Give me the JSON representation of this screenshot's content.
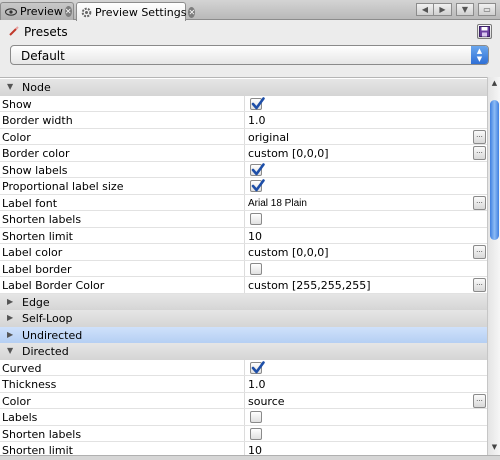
{
  "tabs": [
    {
      "label": "Preview",
      "icon": "preview-eye-icon"
    },
    {
      "label": "Preview Settings",
      "icon": "gear-icon"
    }
  ],
  "presets": {
    "title": "Presets",
    "icon": "presets-wand-icon",
    "selected": "Default",
    "save_icon": "save-disk-icon"
  },
  "sections": [
    {
      "label": "Node",
      "expanded": true,
      "properties": [
        {
          "name": "Show",
          "type": "checkbox",
          "checked": true
        },
        {
          "name": "Border width",
          "type": "text",
          "value": "1.0"
        },
        {
          "name": "Color",
          "type": "text",
          "value": "original",
          "editor": true
        },
        {
          "name": "Border color",
          "type": "text",
          "value": "custom [0,0,0]",
          "editor": true
        },
        {
          "name": "Show labels",
          "type": "checkbox",
          "checked": true
        },
        {
          "name": "Proportional label size",
          "type": "checkbox",
          "checked": true
        },
        {
          "name": "Label font",
          "type": "text",
          "value": "Arial 18 Plain",
          "editor": true
        },
        {
          "name": "Shorten labels",
          "type": "checkbox",
          "checked": false
        },
        {
          "name": "Shorten limit",
          "type": "text",
          "value": "10"
        },
        {
          "name": "Label color",
          "type": "text",
          "value": "custom [0,0,0]",
          "editor": true
        },
        {
          "name": "Label border",
          "type": "checkbox",
          "checked": false
        },
        {
          "name": "Label Border Color",
          "type": "text",
          "value": "custom [255,255,255]",
          "editor": true
        }
      ]
    },
    {
      "label": "Edge",
      "expanded": false,
      "properties": []
    },
    {
      "label": "Self-Loop",
      "expanded": false,
      "properties": []
    },
    {
      "label": "Undirected",
      "expanded": false,
      "selected": true,
      "properties": []
    },
    {
      "label": "Directed",
      "expanded": true,
      "properties": [
        {
          "name": "Curved",
          "type": "checkbox",
          "checked": true
        },
        {
          "name": "Thickness",
          "type": "text",
          "value": "1.0"
        },
        {
          "name": "Color",
          "type": "text",
          "value": "source",
          "editor": true
        },
        {
          "name": "Labels",
          "type": "checkbox",
          "checked": false
        },
        {
          "name": "Shorten labels",
          "type": "checkbox",
          "checked": false
        },
        {
          "name": "Shorten limit",
          "type": "text",
          "value": "10"
        }
      ]
    }
  ],
  "colors": {
    "accent": "#2f6fd6",
    "selection": "#b5cff3",
    "checkmark": "#1e4fa8"
  }
}
